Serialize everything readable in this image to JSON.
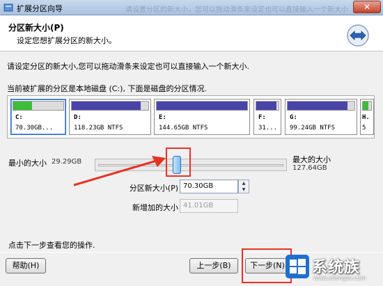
{
  "window": {
    "title": "扩展分区向导",
    "title_ghost": "请设置分区的新大小，您可以拖动滑条来设定也可以直接输入一个新大小"
  },
  "header": {
    "title": "分区新大小(P)",
    "subtitle": "设定您想扩展分区的新大小。",
    "icon": "extend-arrows-icon"
  },
  "description": "请设定分区的新大小,您可以拖动滑条来设定也可以直接输入一个新大小.",
  "current_note": "当前被扩展的分区是本地磁盘 (C:), 下面是磁盘的分区情况.",
  "partitions": [
    {
      "label": "C:",
      "size": "70.30GB...",
      "usage": 0.38,
      "color": "#3fbd3a",
      "selected": true
    },
    {
      "label": "D:",
      "size": "118.23GB NTFS",
      "usage": 0.9,
      "color": "#4a44a8",
      "selected": false
    },
    {
      "label": "E:",
      "size": "144.65GB NTFS",
      "usage": 1.0,
      "color": "#4a44a8",
      "selected": false
    },
    {
      "label": "F:",
      "size": "31...",
      "usage": 0.9,
      "color": "#4a44a8",
      "selected": false
    },
    {
      "label": "G:",
      "size": "99.24GB NTFS",
      "usage": 0.9,
      "color": "#4a44a8",
      "selected": false
    },
    {
      "label": "H.",
      "size": "5",
      "usage": 0.7,
      "color": "#3fbd3a",
      "selected": false
    }
  ],
  "slider": {
    "min_label": "最小的大小",
    "min_value": "29.29GB",
    "max_label": "最大的大小",
    "max_value": "127.64GB"
  },
  "fields": {
    "new_size_label": "分区新大小(P)",
    "new_size_value": "70.30GB",
    "added_label": "新增加的大小",
    "added_value": "41.01GB"
  },
  "hint": "点击下一步查看您的操作.",
  "buttons": {
    "help": "帮助(H)",
    "back": "上一步(B)",
    "next": "下一步(N)"
  },
  "watermark": {
    "text": "系统族",
    "url": "www.xitongzu.com"
  },
  "colors": {
    "accent": "#2f67c7",
    "highlight": "#e53224"
  }
}
